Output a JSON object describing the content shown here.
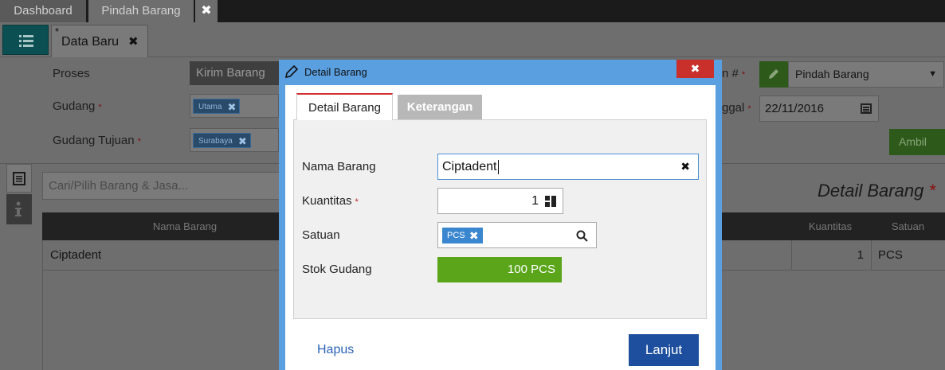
{
  "top_tabs": {
    "dashboard": "Dashboard",
    "pindah": "Pindah Barang",
    "close": "✖"
  },
  "doc_tab": {
    "modified_mark": "*",
    "label": "Data Baru",
    "close": "✖"
  },
  "form": {
    "proses_label": "Proses",
    "proses_value": "Kirim Barang",
    "gudang_label": "Gudang",
    "gudang_value": "Utama",
    "gudang_tujuan_label": "Gudang Tujuan",
    "gudang_tujuan_value": "Surabaya",
    "required_mark": "*",
    "transaksi_label_partial": "n #",
    "transaksi_value": "Pindah Barang",
    "tanggal_label_partial": "ggal",
    "tanggal_value": "22/11/2016",
    "ambil_label": "Ambil"
  },
  "search": {
    "placeholder": "Cari/Pilih Barang & Jasa..."
  },
  "detail_heading": {
    "text": "Detail Barang",
    "required": "*"
  },
  "table": {
    "headers": {
      "nama": "Nama Barang",
      "kuantitas": "Kuantitas",
      "satuan": "Satuan"
    },
    "rows": [
      {
        "nama": "Ciptadent",
        "kuantitas": "1",
        "satuan": "PCS"
      }
    ]
  },
  "modal": {
    "title": "Detail Barang",
    "close": "✖",
    "tabs": {
      "active": "Detail Barang",
      "inactive": "Keterangan"
    },
    "fields": {
      "nama_label": "Nama Barang",
      "nama_value": "Ciptadent",
      "kuantitas_label": "Kuantitas",
      "kuantitas_value": "1",
      "satuan_label": "Satuan",
      "satuan_value": "PCS",
      "stok_label": "Stok Gudang",
      "stok_value": "100 PCS"
    },
    "buttons": {
      "hapus": "Hapus",
      "lanjut": "Lanjut"
    }
  },
  "colors": {
    "modal_frame": "#5a9fe0",
    "close_red": "#c9302c",
    "stock_green": "#5aa51a",
    "primary_blue": "#1d4f9e"
  }
}
